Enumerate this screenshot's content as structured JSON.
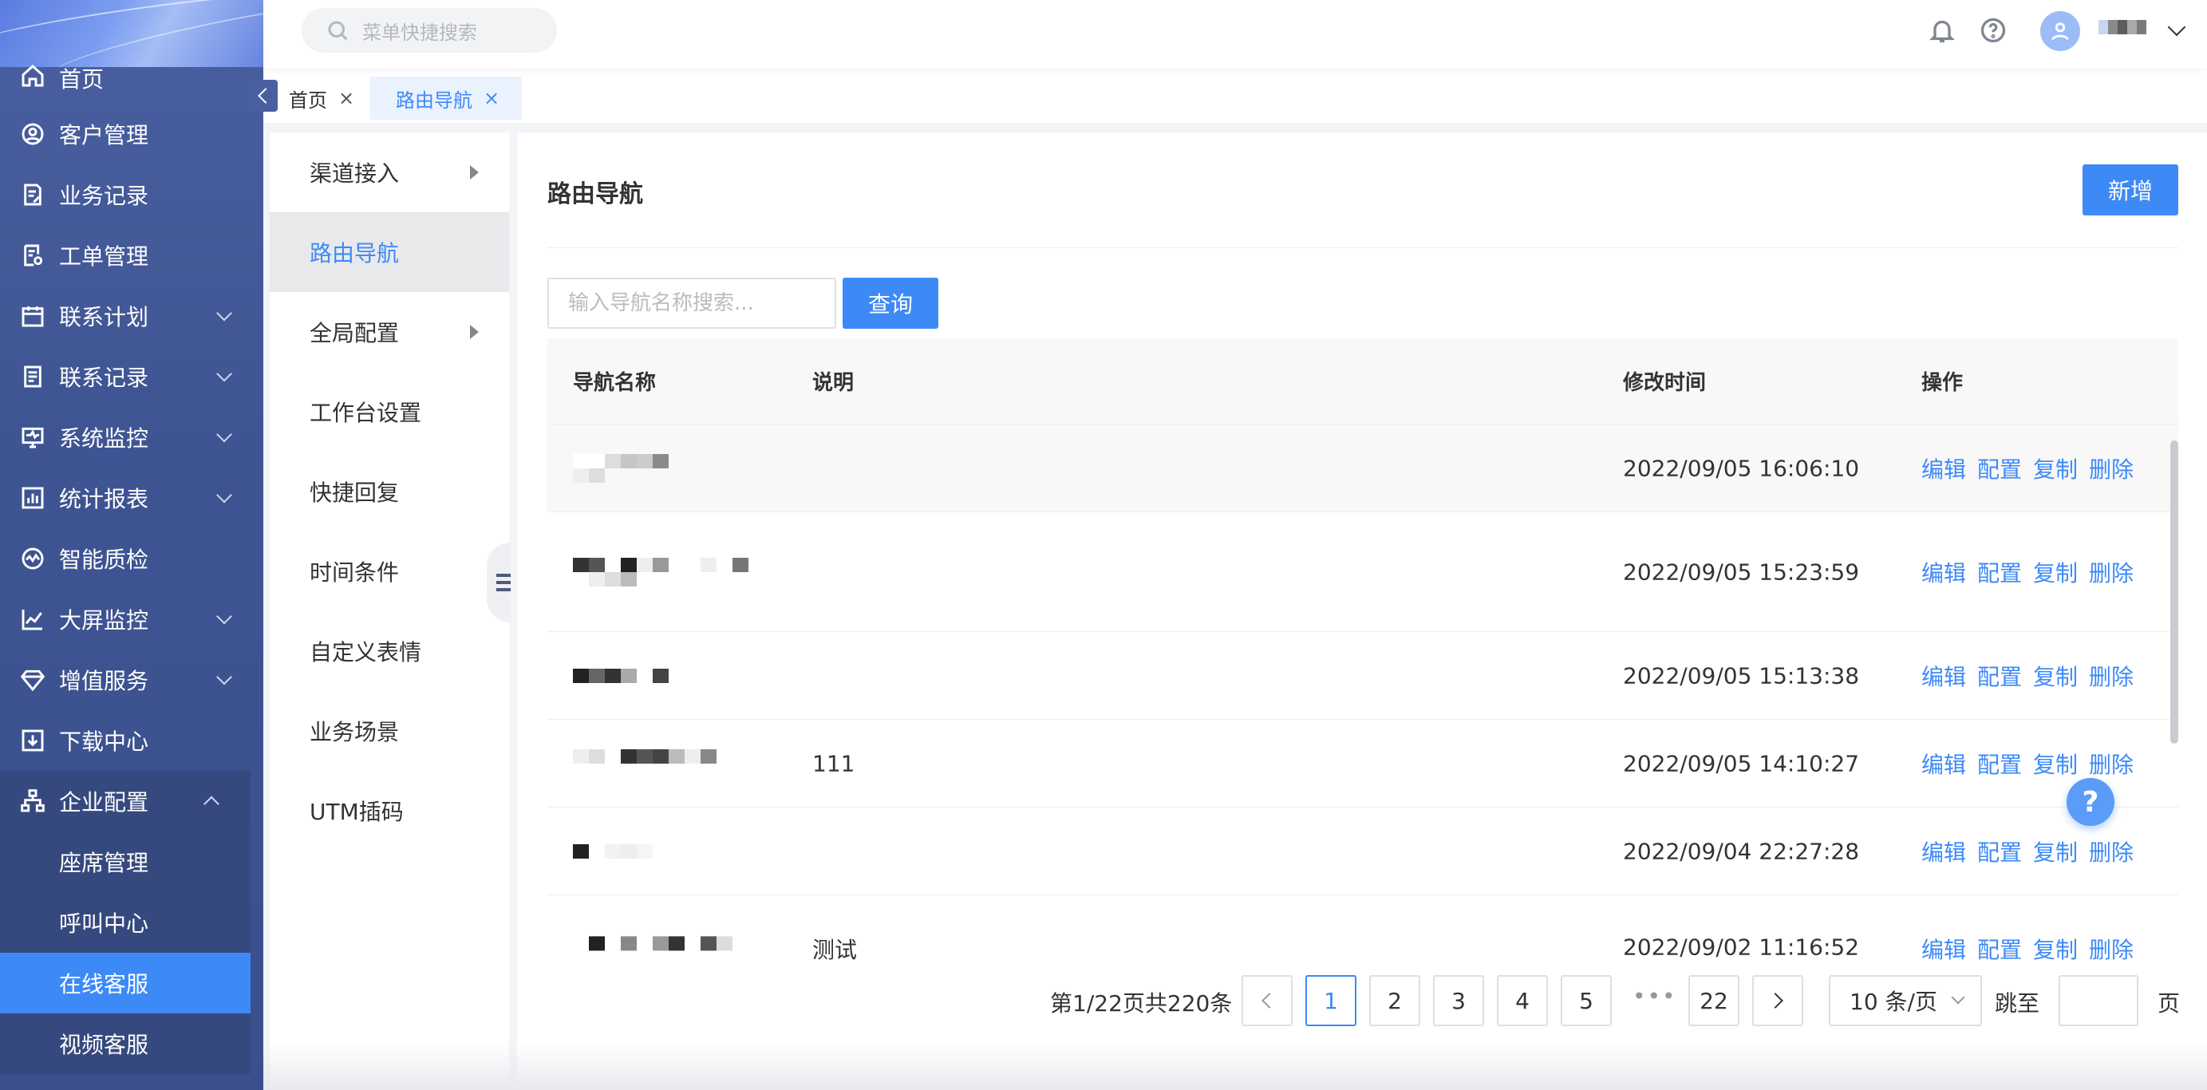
{
  "search": {
    "placeholder": "菜单快捷搜索"
  },
  "sidebar": {
    "items": [
      {
        "label": "首页",
        "icon": "home-icon"
      },
      {
        "label": "客户管理",
        "icon": "user-circle-icon"
      },
      {
        "label": "业务记录",
        "icon": "document-edit-icon"
      },
      {
        "label": "工单管理",
        "icon": "ticket-icon"
      },
      {
        "label": "联系计划",
        "icon": "calendar-icon",
        "expandable": true
      },
      {
        "label": "联系记录",
        "icon": "record-icon",
        "expandable": true
      },
      {
        "label": "系统监控",
        "icon": "monitor-icon",
        "expandable": true
      },
      {
        "label": "统计报表",
        "icon": "bar-chart-icon",
        "expandable": true
      },
      {
        "label": "智能质检",
        "icon": "quality-check-icon"
      },
      {
        "label": "大屏监控",
        "icon": "line-chart-icon",
        "expandable": true
      },
      {
        "label": "增值服务",
        "icon": "diamond-icon",
        "expandable": true
      },
      {
        "label": "下载中心",
        "icon": "download-icon"
      },
      {
        "label": "企业配置",
        "icon": "org-chart-icon",
        "expanded": true
      }
    ],
    "submenu": [
      {
        "label": "座席管理"
      },
      {
        "label": "呼叫中心"
      },
      {
        "label": "在线客服",
        "active": true
      },
      {
        "label": "视频客服"
      }
    ]
  },
  "tabs": [
    {
      "label": "首页"
    },
    {
      "label": "路由导航",
      "active": true
    }
  ],
  "subnav": {
    "items": [
      {
        "label": "渠道接入",
        "has_children": true
      },
      {
        "label": "路由导航",
        "active": true
      },
      {
        "label": "全局配置",
        "has_children": true
      },
      {
        "label": "工作台设置"
      },
      {
        "label": "快捷回复"
      },
      {
        "label": "时间条件"
      },
      {
        "label": "自定义表情"
      },
      {
        "label": "业务场景"
      },
      {
        "label": "UTM插码"
      }
    ]
  },
  "main": {
    "title": "路由导航",
    "add_label": "新增",
    "search_placeholder": "输入导航名称搜索...",
    "query_label": "查询"
  },
  "table": {
    "columns": [
      "导航名称",
      "说明",
      "修改时间",
      "操作"
    ],
    "ops": [
      "编辑",
      "配置",
      "复制",
      "删除"
    ],
    "rows": [
      {
        "name": "",
        "desc": "",
        "time": "2022/09/05 16:06:10"
      },
      {
        "name": "",
        "desc": "",
        "time": "2022/09/05 15:23:59"
      },
      {
        "name": "",
        "desc": "",
        "time": "2022/09/05 15:13:38"
      },
      {
        "name": "",
        "desc": "111",
        "time": "2022/09/05 14:10:27"
      },
      {
        "name": "",
        "desc": "",
        "time": "2022/09/04 22:27:28"
      },
      {
        "name": "",
        "desc": "测试",
        "time": "2022/09/02 11:16:52"
      }
    ]
  },
  "pagination": {
    "summary": "第1/22页共220条",
    "pages": [
      "1",
      "2",
      "3",
      "4",
      "5"
    ],
    "ellipsis": "•••",
    "last_page": "22",
    "current": "1",
    "page_size": "10 条/页",
    "jump_label": "跳至",
    "page_label": "页"
  },
  "help": {
    "label": "?"
  },
  "colors": {
    "primary": "#3d8af7",
    "sidebar": "#3f5593"
  }
}
